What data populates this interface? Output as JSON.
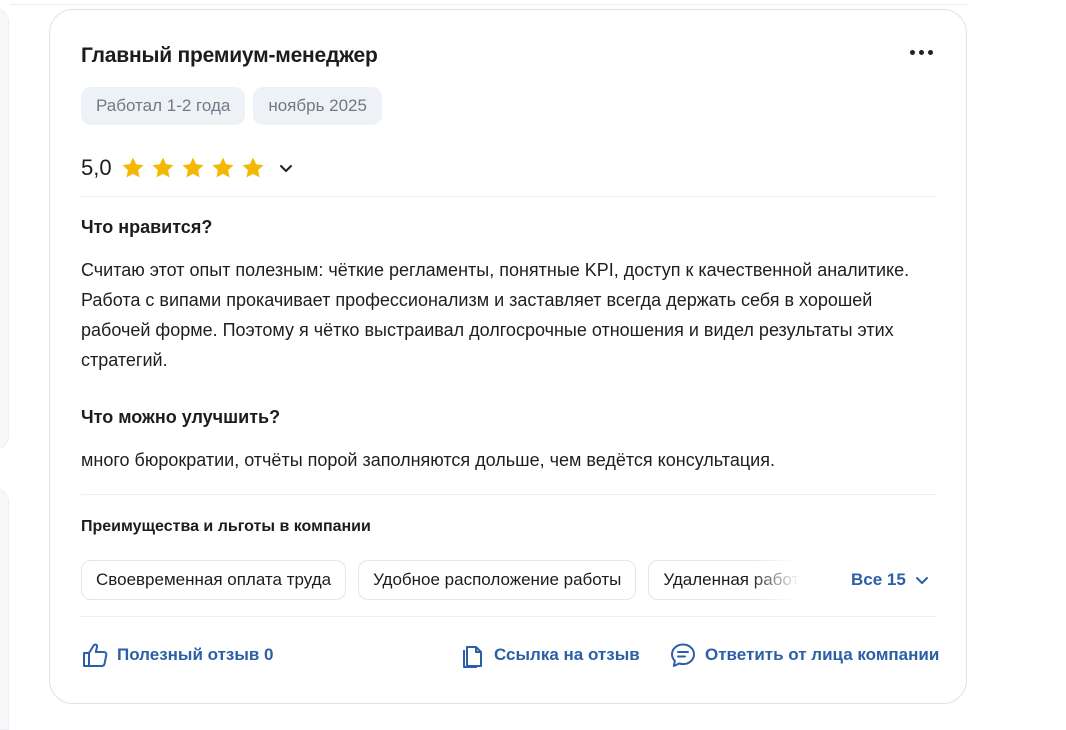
{
  "review": {
    "title": "Главный премиум-менеджер",
    "tags": [
      "Работал 1-2 года",
      "ноябрь 2025"
    ],
    "rating": "5,0",
    "stars": 5,
    "pros_heading": "Что нравится?",
    "pros_text": "Считаю этот опыт полезным: чёткие регламенты, понятные KPI, доступ к качественной аналитике. Работа с випами прокачивает профессионализм и заставляет всегда держать себя в хорошей рабочей форме. Поэтому я чётко выстраивал долгосрочные отношения и видел результаты этих стратегий.",
    "cons_heading": "Что можно улучшить?",
    "cons_text": "много бюрократии, отчёты порой заполняются дольше, чем ведётся консультация."
  },
  "benefits": {
    "heading": "Преимущества и льготы в компании",
    "items": [
      "Своевременная оплата труда",
      "Удобное расположение работы",
      "Удаленная работа"
    ],
    "all_label": "Все 15"
  },
  "actions": {
    "helpful_label": "Полезный отзыв 0",
    "link_label": "Ссылка на отзыв",
    "reply_label": "Ответить от лица компании"
  },
  "colors": {
    "star": "#f5b800",
    "link": "#2b5fa8",
    "tag_bg": "#eef1f5"
  },
  "icons": [
    "more-icon",
    "star-icon",
    "chevron-down-icon",
    "thumbs-up-icon",
    "copy-icon",
    "chat-icon"
  ]
}
